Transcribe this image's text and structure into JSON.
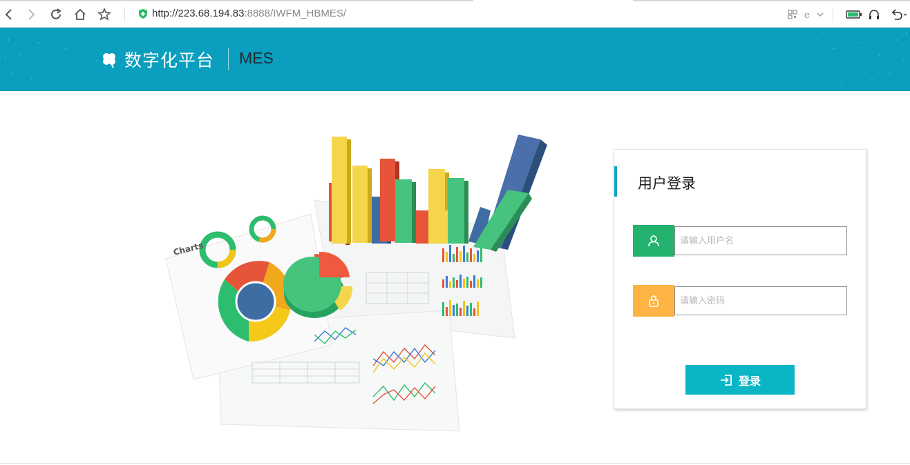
{
  "browser": {
    "url_host": "http://223.68.194.83",
    "url_path": ":8888/IWFM_HBMES/"
  },
  "header": {
    "brand_name": "数字化平台",
    "system_name": "MES"
  },
  "login": {
    "title": "用户登录",
    "username_placeholder": "请输入用户名",
    "password_placeholder": "请输入密码",
    "submit_label": "登录"
  },
  "colors": {
    "header_bg": "#0a9fbe",
    "user_icon_bg": "#24b36e",
    "lock_icon_bg": "#fdb444",
    "button_bg": "#0ab5c6",
    "accent": "#0ba6c3"
  },
  "icons": {
    "back": "back-arrow-icon",
    "forward": "forward-arrow-icon",
    "reload": "reload-icon",
    "home": "home-icon",
    "bookmark": "star-icon",
    "secure": "shield-icon",
    "user": "user-icon",
    "lock": "lock-icon",
    "login": "sign-in-icon"
  }
}
